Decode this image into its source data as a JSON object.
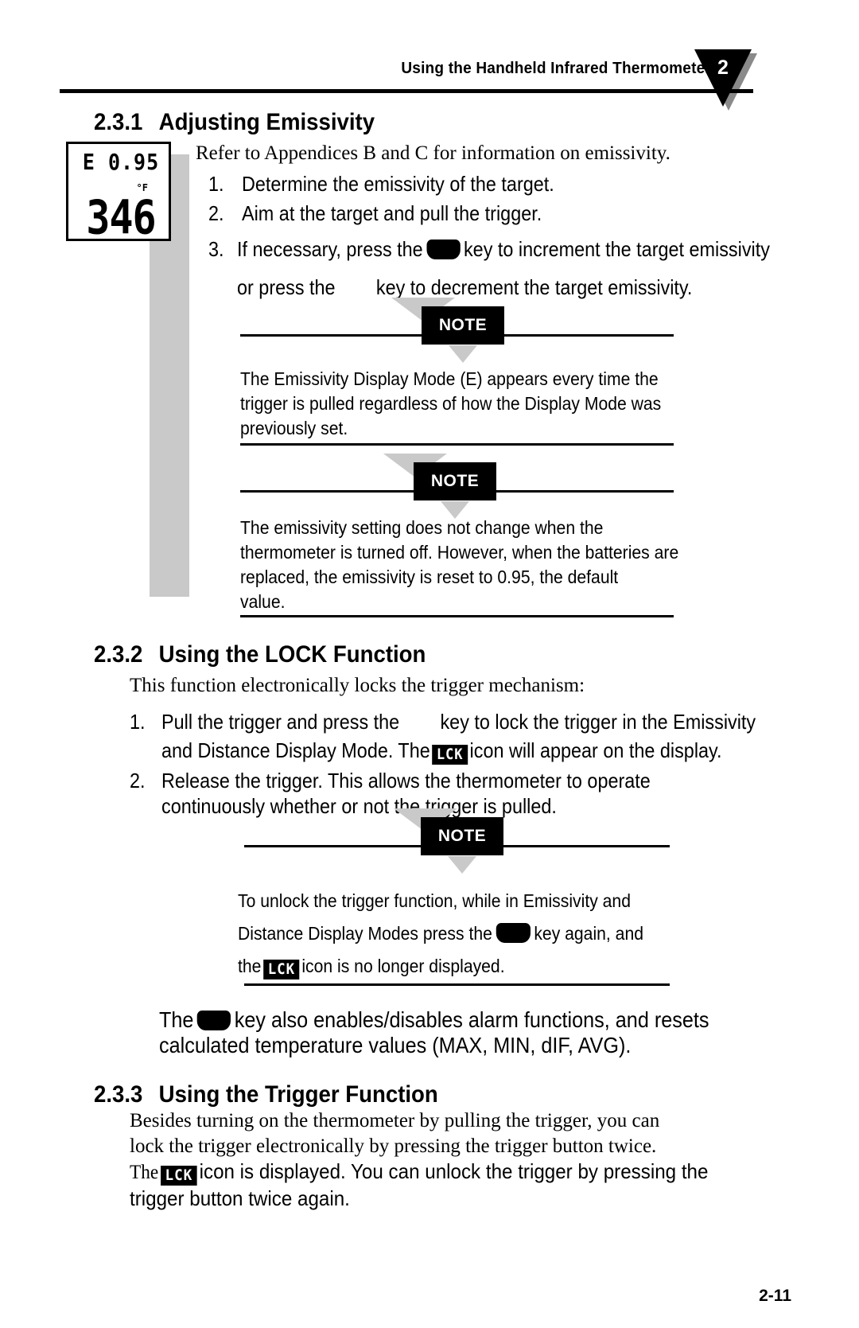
{
  "header": {
    "title": "Using the Handheld Infrared Thermometer",
    "chapter_number": "2"
  },
  "lcd": {
    "emissivity_line": "E 0.95",
    "unit": "°F",
    "temperature": "346"
  },
  "sections": {
    "s231": {
      "number": "2.3.1",
      "title": "Adjusting Emissivity",
      "intro": "Refer to Appendices B and C for information on emissivity.",
      "steps": [
        {
          "mark": "1.",
          "text": "Determine the emissivity of the target."
        },
        {
          "mark": "2.",
          "text": "Aim at the target and pull the trigger."
        },
        {
          "mark": "3.",
          "line1_a": "If necessary, press the",
          "line1_b": "key to increment the target emissivity",
          "line2_a": "or press the",
          "line2_b": "key to decrement the target emissivity."
        }
      ],
      "note1": {
        "label": "NOTE",
        "lines": [
          "The Emissivity Display Mode (E) appears every time the",
          "trigger is pulled regardless of how the Display Mode was",
          "previously set."
        ]
      },
      "note2": {
        "label": "NOTE",
        "lines": [
          "The emissivity setting does not change when the",
          "thermometer is turned off. However, when the batteries are",
          "replaced, the emissivity is reset to 0.95, the default",
          "value."
        ]
      }
    },
    "s232": {
      "number": "2.3.2",
      "title": "Using the LOCK Function",
      "intro": "This function electronically locks the trigger mechanism:",
      "steps": [
        {
          "mark": "1.",
          "line1_a": "Pull the trigger and press the",
          "line1_b": "key to lock the trigger in the Emissivity",
          "line2_a": "and Distance Display Mode. The",
          "line2_icon": "LCK",
          "line2_b": "icon will appear on the display."
        },
        {
          "mark": "2.",
          "line1": "Release the trigger. This allows the thermometer to operate",
          "line2": "continuously whether or not the trigger is pulled."
        }
      ],
      "note3": {
        "label": "NOTE",
        "line1": "To unlock the trigger function, while in Emissivity and",
        "line2_a": "Distance Display Modes press the",
        "line2_b": "key again, and",
        "line3_a": "the",
        "line3_icon": "LCK",
        "line3_b": "icon is no longer displayed."
      },
      "closing": {
        "line1_a": "The",
        "line1_b": "key also enables/disables alarm functions, and resets",
        "line2": "calculated temperature values (MAX, MIN, dIF, AVG)."
      }
    },
    "s233": {
      "number": "2.3.3",
      "title": "Using the Trigger Function",
      "lines": [
        "Besides turning on the thermometer by pulling the trigger, you can",
        "lock the trigger electronically by pressing the trigger button twice."
      ],
      "line3_a": "The",
      "line3_icon": "LCK",
      "line3_b": "icon is displayed. You can unlock the trigger by pressing the",
      "line4": "trigger button twice again."
    }
  },
  "footer": {
    "page_number": "2-11"
  }
}
